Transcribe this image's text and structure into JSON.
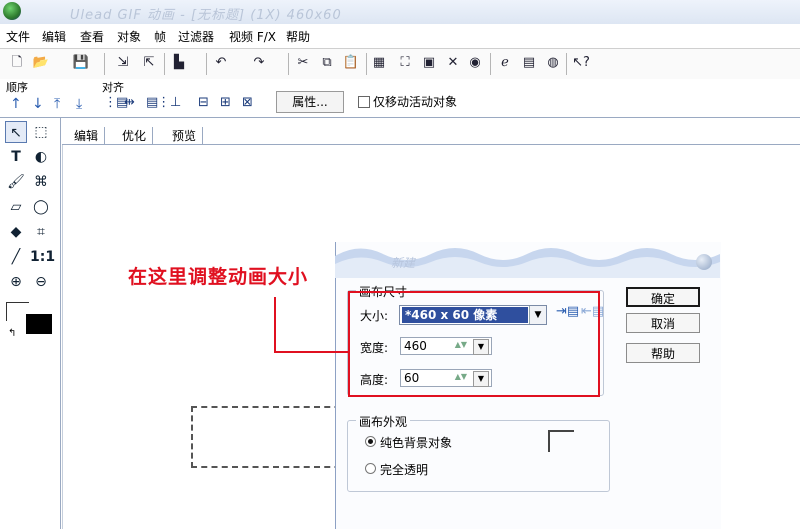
{
  "window": {
    "title": "Ulead GIF 动画 - [无标题] (1X) 460x60"
  },
  "menu": [
    "文件",
    "编辑",
    "查看",
    "对象",
    "帧",
    "过滤器",
    "视频 F/X",
    "帮助"
  ],
  "toolbar": {
    "icons": [
      "new-icon",
      "open-icon",
      "save-icon",
      "import-icon",
      "export-icon",
      "launch-icon",
      "undo-icon",
      "redo-icon",
      "cut-icon",
      "copy-icon",
      "paste-icon",
      "canvas-size-icon",
      "crop-icon",
      "image-info-icon",
      "fit-icon",
      "web-icon",
      "ie-icon",
      "preview-icon",
      "globe-icon",
      "help-cursor-icon"
    ]
  },
  "rowbar": {
    "order_label": "顺序",
    "align_label": "对齐",
    "properties_label": "属性...",
    "move_active_label": "仅移动活动对象"
  },
  "tabs": [
    "编辑",
    "优化",
    "预览"
  ],
  "tools": [
    "pick-tool",
    "marquee-tool",
    "text-tool",
    "lasso-tool",
    "paintbrush-tool",
    "magic-wand-tool",
    "eraser-tool",
    "ellipse-select-tool",
    "paint-bucket-tool",
    "crop-tool",
    "eyedropper-tool",
    "actual-size-tool",
    "zoom-in-tool",
    "zoom-out-tool"
  ],
  "tool_glyphs": {
    "actual_size": "1:1"
  },
  "colors": {
    "accent": "#2f4f9e",
    "annotation": "#e01020",
    "foreground": "#000000"
  },
  "dialog": {
    "title": "新建",
    "canvas_size_group": "画布尺寸",
    "size_label": "大小:",
    "size_value": "*460 x 60 像素",
    "width_label": "宽度:",
    "width_value": "460",
    "height_label": "高度:",
    "height_value": "60",
    "canvas_appearance_group": "画布外观",
    "solid_background_label": "纯色背景对象",
    "transparent_label": "完全透明",
    "selected_appearance": "纯色背景对象",
    "ok_label": "确定",
    "cancel_label": "取消",
    "help_label": "帮助"
  },
  "annotation": {
    "text": "在这里调整动画大小"
  }
}
